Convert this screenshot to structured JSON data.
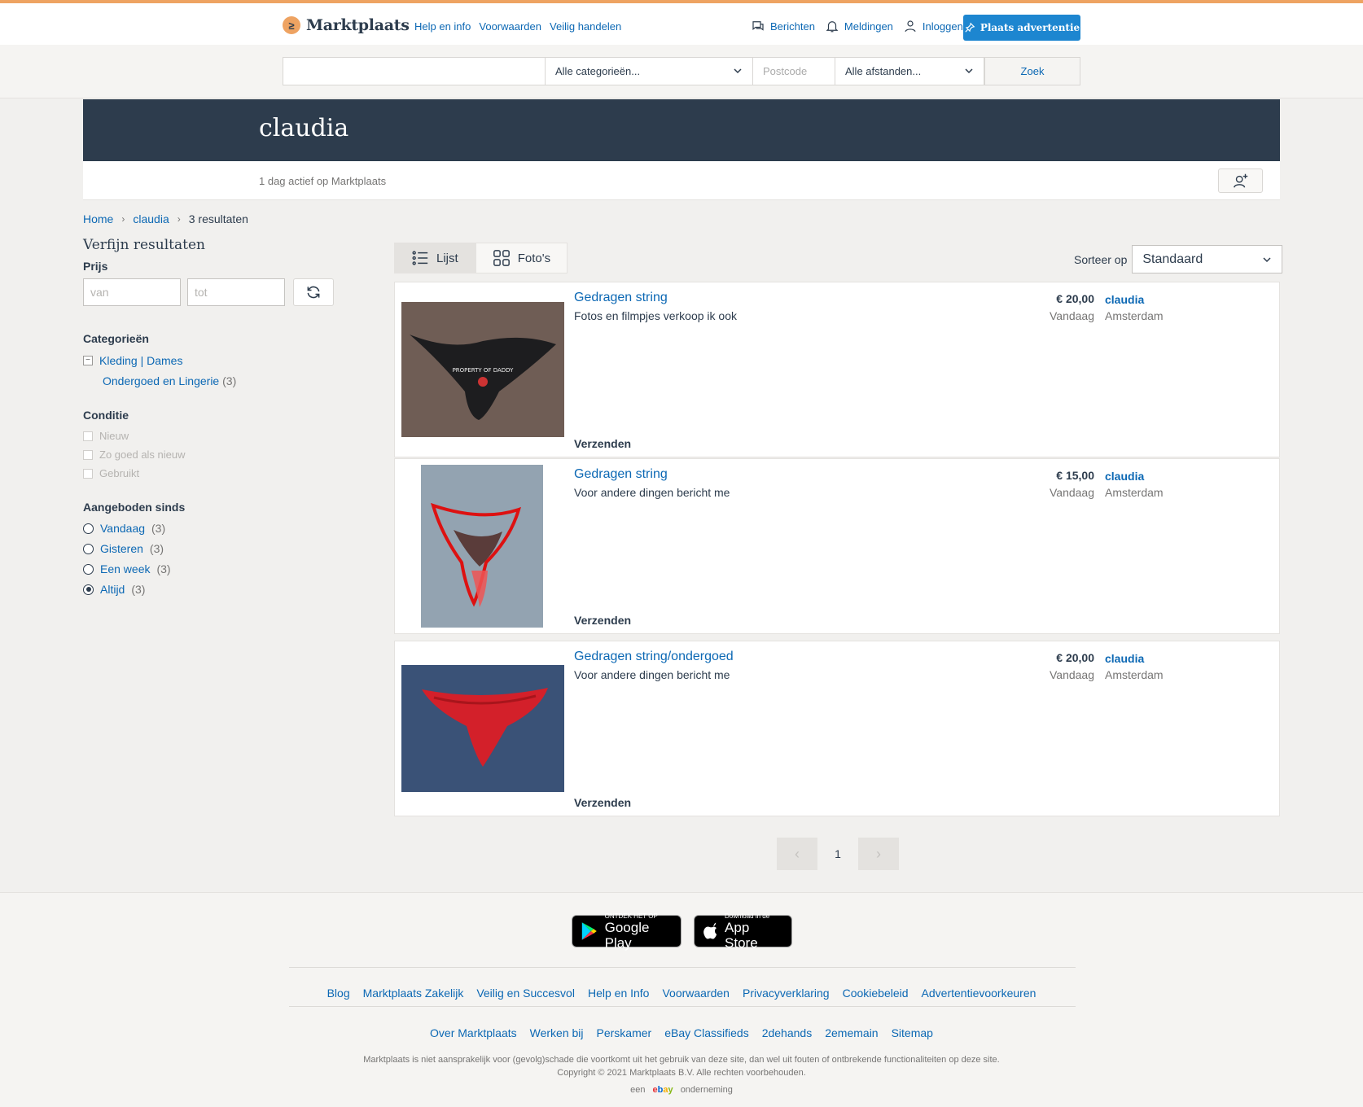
{
  "header": {
    "logo": "Marktplaats",
    "links": [
      "Help en info",
      "Voorwaarden",
      "Veilig handelen"
    ],
    "berichten": "Berichten",
    "meldingen": "Meldingen",
    "inloggen": "Inloggen",
    "place_ad": "Plaats advertentie"
  },
  "search": {
    "query": "",
    "category": "Alle categorieën...",
    "postcode_placeholder": "Postcode",
    "distance": "Alle afstanden...",
    "submit": "Zoek"
  },
  "profile": {
    "name": "claudia",
    "active": "1 dag actief op Marktplaats"
  },
  "breadcrumb": [
    "Home",
    "claudia",
    "3 resultaten"
  ],
  "sidebar": {
    "title": "Verfijn resultaten",
    "price_label": "Prijs",
    "price_from": "van",
    "price_to": "tot",
    "categories_title": "Categorieën",
    "category": "Kleding | Dames",
    "subcategory": "Ondergoed en Lingerie",
    "subcategory_count": "(3)",
    "condition_title": "Conditie",
    "conditions": [
      "Nieuw",
      "Zo goed als nieuw",
      "Gebruikt"
    ],
    "since_title": "Aangeboden sinds",
    "since": [
      {
        "label": "Vandaag",
        "count": "(3)"
      },
      {
        "label": "Gisteren",
        "count": "(3)"
      },
      {
        "label": "Een week",
        "count": "(3)"
      },
      {
        "label": "Altijd",
        "count": "(3)"
      }
    ]
  },
  "view": {
    "list": "Lijst",
    "photos": "Foto's"
  },
  "sort": {
    "label": "Sorteer op",
    "value": "Standaard"
  },
  "listings": [
    {
      "title": "Gedragen string",
      "desc": "Fotos en filmpjes verkoop ik ook",
      "price": "€ 20,00",
      "date": "Vandaag",
      "seller": "claudia",
      "location": "Amsterdam",
      "shipping": "Verzenden",
      "thumb_text": "PROPERTY OF DADDY"
    },
    {
      "title": "Gedragen string",
      "desc": "Voor andere dingen bericht me",
      "price": "€ 15,00",
      "date": "Vandaag",
      "seller": "claudia",
      "location": "Amsterdam",
      "shipping": "Verzenden"
    },
    {
      "title": "Gedragen string/ondergoed",
      "desc": "Voor andere dingen bericht me",
      "price": "€ 20,00",
      "date": "Vandaag",
      "seller": "claudia",
      "location": "Amsterdam",
      "shipping": "Verzenden"
    }
  ],
  "pager": {
    "page": "1"
  },
  "footer": {
    "google_small": "ONTDEK HET OP",
    "google_big": "Google Play",
    "apple_small": "Download in de",
    "apple_big": "App Store",
    "links1": [
      "Blog",
      "Marktplaats Zakelijk",
      "Veilig en Succesvol",
      "Help en Info",
      "Voorwaarden",
      "Privacyverklaring",
      "Cookiebeleid",
      "Advertentievoorkeuren"
    ],
    "links2": [
      "Over Marktplaats",
      "Werken bij",
      "Perskamer",
      "eBay Classifieds",
      "2dehands",
      "2ememain",
      "Sitemap"
    ],
    "disclaimer": "Marktplaats is niet aansprakelijk voor (gevolg)schade die voortkomt uit het gebruik van deze site, dan wel uit fouten of ontbrekende functionaliteiten op deze site.",
    "copyright": "Copyright © 2021 Marktplaats B.V. Alle rechten voorbehouden.",
    "een": "een",
    "onderneming": "onderneming"
  }
}
